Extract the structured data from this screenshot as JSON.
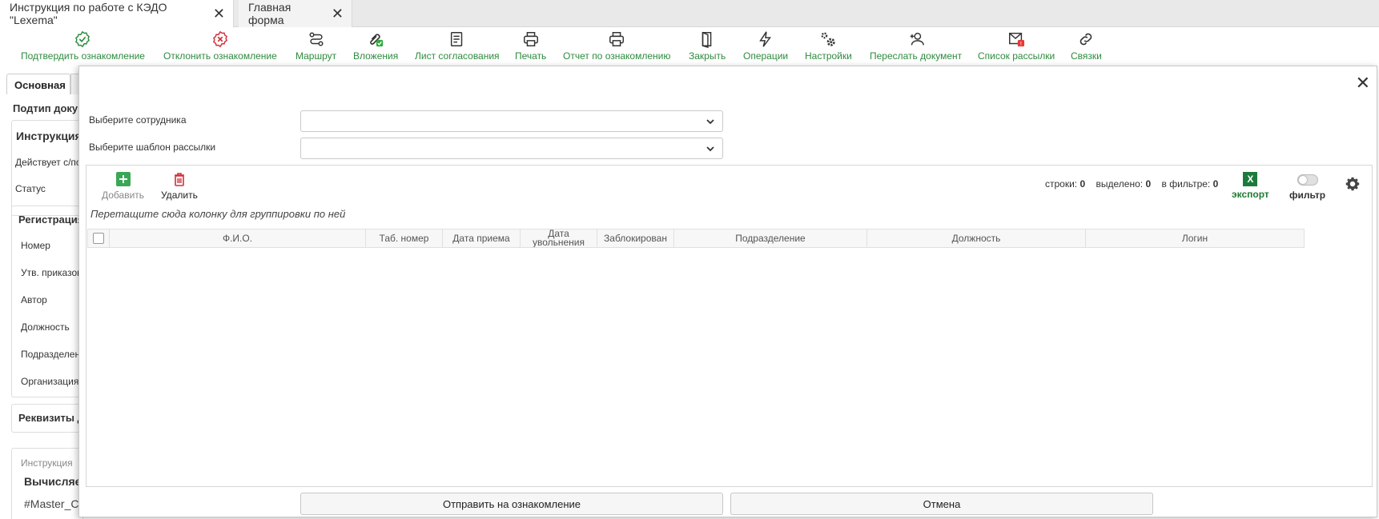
{
  "tabs": [
    {
      "label": "Инструкция по работе с КЭДО \"Lexema\""
    },
    {
      "label": "Главная форма"
    }
  ],
  "toolbar": {
    "confirm": "Подтвердить ознакомление",
    "reject": "Отклонить ознакомление",
    "route": "Маршрут",
    "attachments": "Вложения",
    "approval_sheet": "Лист согласования",
    "print": "Печать",
    "report": "Отчет по ознакомлению",
    "close": "Закрыть",
    "operations": "Операции",
    "settings": "Настройки",
    "forward": "Переслать документ",
    "mailing_list": "Список рассылки",
    "links": "Связки"
  },
  "background": {
    "tab_main": "Основная",
    "subtype": "Подтип доку",
    "instruction": "Инструкция",
    "valid_from": "Действует с/по",
    "status": "Статус",
    "registration": "Регистрация",
    "number": "Номер",
    "approved_by": "Утв. приказом",
    "author": "Автор",
    "position": "Должность",
    "department": "Подразделен",
    "organization": "Организация",
    "requisites": "Реквизиты д",
    "instruction2": "Инструкция",
    "computed": "Вычисляе",
    "master": "#Master_C"
  },
  "modal": {
    "employee_label": "Выберите сотрудника",
    "template_label": "Выберите шаблон рассылки",
    "add": "Добавить",
    "delete": "Удалить",
    "stats": {
      "rows_label": "строки:",
      "rows": "0",
      "selected_label": "выделено:",
      "selected": "0",
      "filtered_label": "в фильтре:",
      "filtered": "0"
    },
    "export": "экспорт",
    "filter": "фильтр",
    "group_hint": "Перетащите сюда колонку для группировки по ней",
    "columns": [
      "Ф.И.О.",
      "Таб. номер",
      "Дата приема",
      "Дата увольнения",
      "Заблокирован",
      "Подразделение",
      "Должность",
      "Логин"
    ],
    "send": "Отправить на ознакомление",
    "cancel": "Отмена"
  },
  "colors": {
    "green": "#2e8b3e",
    "red": "#d0303a"
  }
}
